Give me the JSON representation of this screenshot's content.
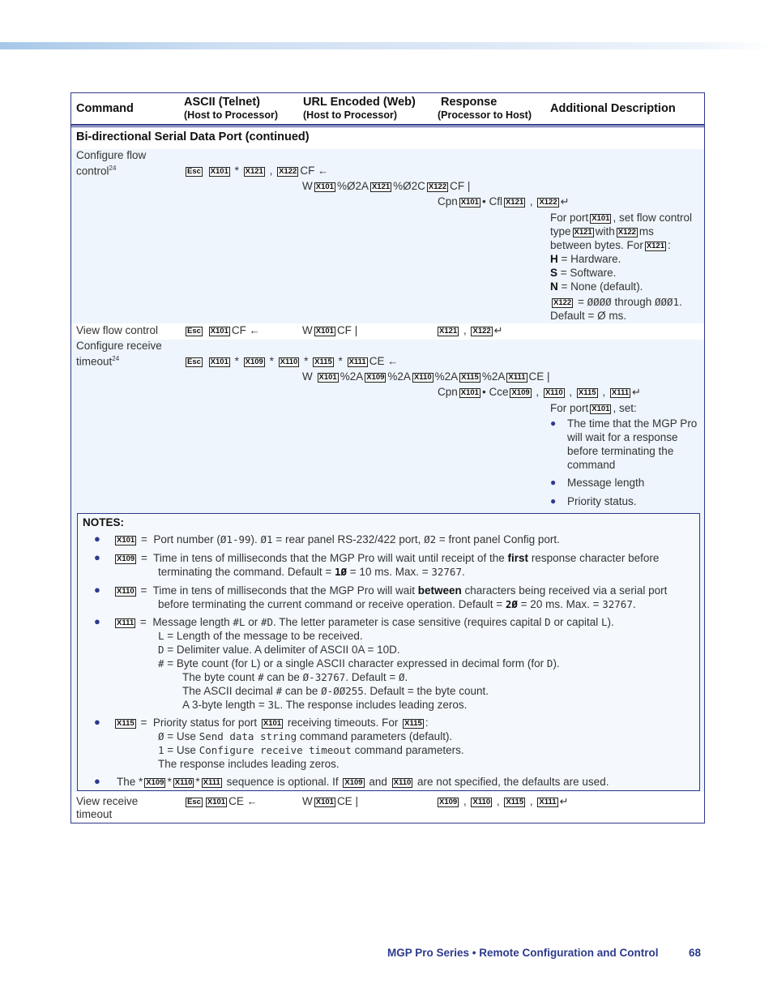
{
  "table": {
    "headers": {
      "command": "Command",
      "ascii": "ASCII (Telnet)",
      "ascii_sub": "(Host to Processor)",
      "url": "URL Encoded (Web)",
      "url_sub": "(Host to Processor)",
      "response": "Response",
      "response_sub": "(Processor to Host)",
      "description": "Additional Description"
    },
    "section_title": "Bi-directional Serial Data Port (continued)",
    "rows": [
      {
        "command_line1": "Configure flow",
        "command_line2": "control",
        "footnote": "24",
        "ascii": {
          "esc": "Esc",
          "p1": "X101",
          "sep1": "*",
          "p2": "X121",
          "sep2": ",",
          "p3": "X122",
          "cmd": "CF",
          "terminator": "←"
        },
        "url": {
          "w": "W",
          "p1": "X101",
          "enc1": "%Ø2A",
          "p2": "X121",
          "enc2": "%Ø2C",
          "p3": "X122",
          "cmd": "CF",
          "terminator": "|"
        },
        "response": {
          "prefix": "Cpn",
          "p1": "X101",
          "bullet": "•",
          "mid": "Cfl",
          "p2": "X121",
          "sep": ",",
          "p3": "X122",
          "terminator": "↵"
        },
        "description": {
          "line1_a": "For port",
          "line1_p": "X101",
          "line1_b": ", set flow control",
          "line2_a": "type",
          "line2_p1": "X121",
          "line2_b": "with",
          "line2_p2": "X122",
          "line2_c": "ms",
          "line3_a": "between bytes. For",
          "line3_p": "X121",
          "line3_b": ":",
          "opts": [
            {
              "key": "H",
              "text": " = Hardware."
            },
            {
              "key": "S",
              "text": " = Software."
            },
            {
              "key": "N",
              "text": " = None (default)."
            }
          ],
          "range_p": "X122",
          "range_a": " = ",
          "range_from": "ØØØØ",
          "range_b": " through ",
          "range_to": "ØØØ1",
          "range_c": ".",
          "default": "Default = Ø ms."
        }
      },
      {
        "command": "View flow control",
        "ascii": {
          "esc": "Esc",
          "p1": "X101",
          "cmd": "CF",
          "terminator": "←"
        },
        "url": {
          "w": "W",
          "p1": "X101",
          "cmd": "CF",
          "terminator": "|"
        },
        "response": {
          "p1": "X121",
          "sep": ",",
          "p2": "X122",
          "terminator": "↵"
        }
      },
      {
        "command_line1": "Configure receive",
        "command_line2": "timeout",
        "footnote": "24",
        "ascii": {
          "esc": "Esc",
          "p1": "X101",
          "p2": "X109",
          "p3": "X110",
          "p4": "X115",
          "p5": "X111",
          "sep": "*",
          "cmd": "CE",
          "terminator": "←"
        },
        "url": {
          "w": "W",
          "p1": "X101",
          "p2": "X109",
          "p3": "X110",
          "p4": "X115",
          "p5": "X111",
          "enc": "%2A",
          "cmd": "CE",
          "terminator": "|"
        },
        "response": {
          "prefix": "Cpn",
          "p1": "X101",
          "bullet": "•",
          "mid": "Cce",
          "p2": "X109",
          "p3": "X110",
          "p4": "X115",
          "p5": "X111",
          "sep": ",",
          "terminator": "↵"
        },
        "description": {
          "intro_a": "For port",
          "intro_p": "X101",
          "intro_b": ", set:",
          "bullets": [
            [
              "The time that the MGP Pro",
              "will wait for a response",
              "before terminating the",
              "command"
            ],
            [
              "Message length"
            ],
            [
              "Priority status."
            ]
          ]
        }
      },
      {
        "command_line1": "View receive",
        "command_line2": "timeout",
        "ascii": {
          "esc": "Esc",
          "p1": "X101",
          "cmd": "CE",
          "terminator": "←"
        },
        "url": {
          "w": "W",
          "p1": "X101",
          "cmd": "CE",
          "terminator": "|"
        },
        "response": {
          "p1": "X109",
          "p2": "X110",
          "p3": "X115",
          "p4": "X111",
          "sep": ",",
          "terminator": "↵"
        }
      }
    ],
    "notes": {
      "title": "NOTES:",
      "eq": "=",
      "n1": {
        "p": "X101",
        "a": "Port number (",
        "v1": "Ø1-99",
        "b": "). ",
        "v2": "Ø1",
        "c": " = rear panel RS-232/422 port, ",
        "v3": "Ø2",
        "d": " = front panel Config port."
      },
      "n2": {
        "p": "X109",
        "a": "Time in tens of milliseconds that the MGP Pro will wait until receipt of the ",
        "bold": "first",
        "b": " response character before",
        "line2_a": "terminating the command. Default = ",
        "v1": "1Ø",
        "line2_b": " = 10 ms. Max. = ",
        "v2": "32767",
        "line2_c": "."
      },
      "n3": {
        "p": "X110",
        "a": "Time in tens of milliseconds that the MGP Pro will wait ",
        "bold": "between",
        "b": " characters being received via a serial port",
        "line2_a": "before terminating the current command or receive operation. Default = ",
        "v1": "2Ø",
        "line2_b": " = 20 ms. Max. = ",
        "v2": "32767",
        "line2_c": "."
      },
      "n4": {
        "p": "X111",
        "a": "Message length ",
        "v1": "#L",
        "b": " or ",
        "v2": "#D",
        "c": ". The letter parameter is case sensitive (requires capital ",
        "v3": "D",
        "d": " or capital ",
        "v4": "L",
        "e": ").",
        "l_key": "L",
        "l_text": "=  Length of the message to be received.",
        "d_key": "D",
        "d_text": "=  Delimiter value. A delimiter of ASCII 0A = 10D.",
        "h_key": "#",
        "h_text_a": "=  Byte count (for ",
        "h_v1": "L",
        "h_text_b": ") or a single ASCII character expressed in decimal form (for ",
        "h_v2": "D",
        "h_text_c": ").",
        "s1_a": "The byte count ",
        "s1_h": "#",
        "s1_b": " can be ",
        "s1_v": "Ø-32767",
        "s1_c": ". Default = ",
        "s1_d": "Ø",
        "s1_e": ".",
        "s2_a": "The ASCII decimal ",
        "s2_h": "#",
        "s2_b": " can be ",
        "s2_v": "Ø-ØØ255",
        "s2_c": ". Default = the byte count.",
        "s3_a": "A 3-byte length = ",
        "s3_v": "3L",
        "s3_b": ". The response includes leading zeros."
      },
      "n5": {
        "p": "X115",
        "a": "Priority status for port ",
        "p2": "X101",
        "b": " receiving timeouts. For ",
        "p3": "X115",
        "c": ":",
        "o1_k": "Ø",
        "o1_a": " = Use ",
        "o1_m": "Send data string",
        "o1_b": " command parameters (default).",
        "o2_k": "1",
        "o2_a": " = Use ",
        "o2_m": "Configure receive timeout",
        "o2_b": " command parameters.",
        "o3": "The response includes leading zeros."
      },
      "n6": {
        "a": "The ",
        "s": "*",
        "p1": "X109",
        "p2": "X110",
        "p3": "X111",
        "b": " sequence is optional. If ",
        "p4": "X109",
        "c": " and ",
        "p5": "X110",
        "d": " are not specified, the defaults are used."
      }
    }
  },
  "footer": {
    "text": "MGP Pro Series • Remote Configuration and Control",
    "page": "68"
  }
}
